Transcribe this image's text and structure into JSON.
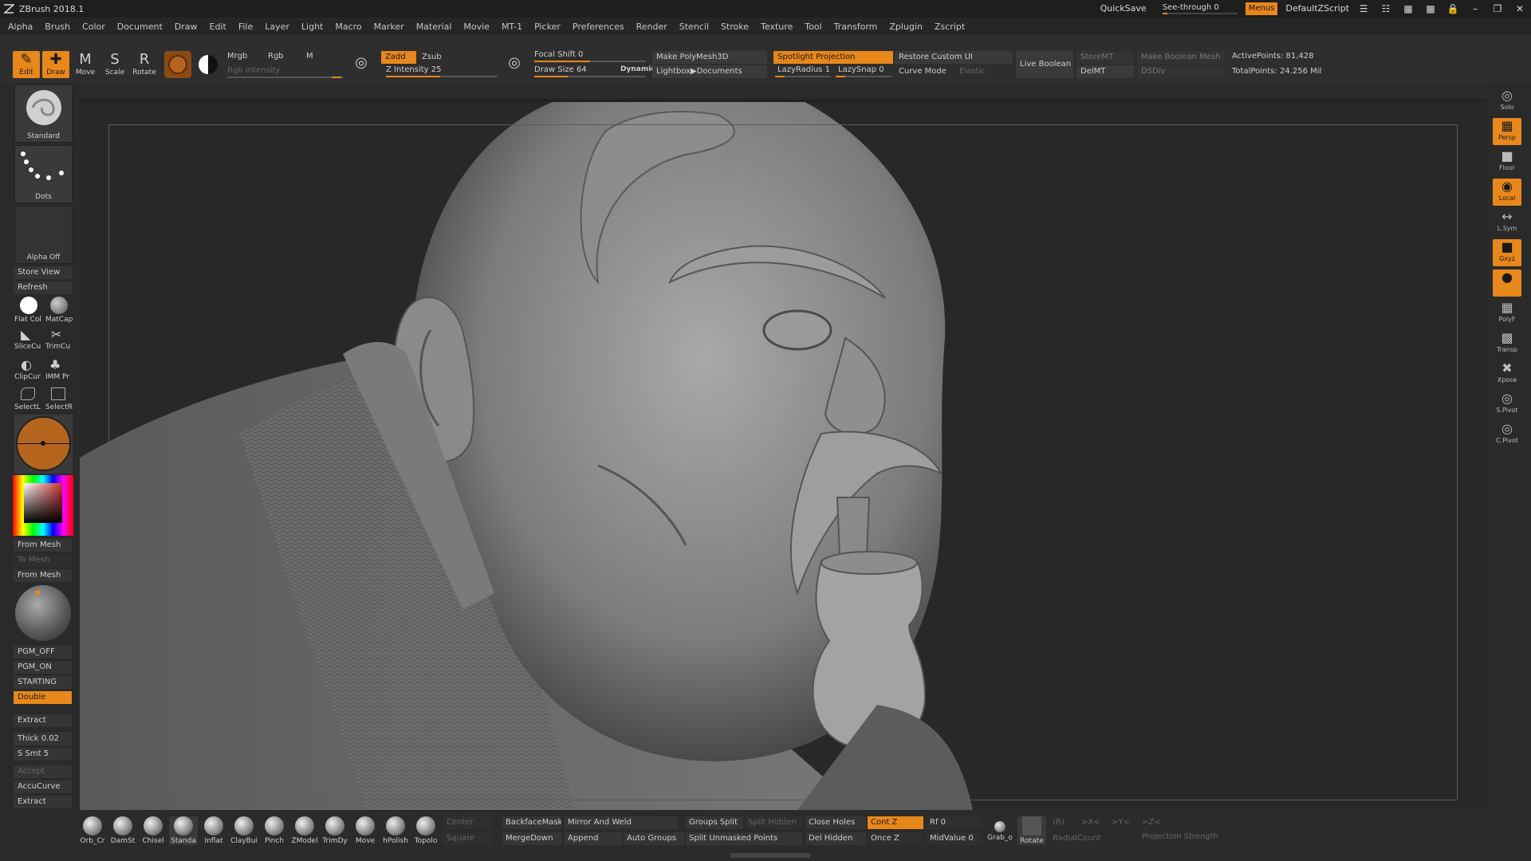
{
  "app": {
    "title": "ZBrush 2018.1"
  },
  "titlebar": {
    "quicksave": "QuickSave",
    "seethrough": "See-through   0",
    "menus": "Menus",
    "script": "DefaultZScript"
  },
  "menu": [
    "Alpha",
    "Brush",
    "Color",
    "Document",
    "Draw",
    "Edit",
    "File",
    "Layer",
    "Light",
    "Macro",
    "Marker",
    "Material",
    "Movie",
    "MT-1",
    "Picker",
    "Preferences",
    "Render",
    "Stencil",
    "Stroke",
    "Texture",
    "Tool",
    "Transform",
    "Zplugin",
    "Zscript"
  ],
  "toolbar": {
    "edit": "Edit",
    "draw": "Draw",
    "move": "Move",
    "scale": "Scale",
    "rotate": "Rotate",
    "mrgb": "Mrgb",
    "rgb": "Rgb",
    "m": "M",
    "rgb_intensity": "Rgb Intensity",
    "zadd": "Zadd",
    "zsub": "Zsub",
    "z_intensity": "Z Intensity 25",
    "focal_shift": "Focal Shift 0",
    "draw_size": "Draw Size 64",
    "dynamic": "Dynamic",
    "make_polymesh": "Make PolyMesh3D",
    "lightbox": "Lightbox▶Documents",
    "spotlight": "Spotlight Projection",
    "lazyradius": "LazyRadius 1",
    "lazysnap": "LazySnap 0",
    "restore_ui": "Restore Custom UI",
    "curve_mode": "Curve Mode",
    "elastic": "Elastic",
    "live_boolean": "Live Boolean",
    "storemt": "StoreMT",
    "delmt": "DelMT",
    "make_boolean": "Make Boolean Mesh",
    "dsdiv": "DSDiv",
    "active_points": "ActivePoints: 81,428",
    "total_points": "TotalPoints: 24.256 Mil"
  },
  "left": {
    "standard": "Standard",
    "dots": "Dots",
    "alpha_off": "Alpha Off",
    "store_view": "Store View",
    "refresh": "Refresh",
    "flat_col": "Flat Col",
    "matcap": "MatCap",
    "slicecu": "SliceCu",
    "trimcu": "TrimCu",
    "clipcur": "ClipCur",
    "imm": "IMM Pr",
    "selectl": "SelectL",
    "selectr": "SelectR",
    "from_mesh": "From Mesh",
    "to_mesh": "To Mesh",
    "from_mesh2": "From Mesh",
    "pgm_off": "PGM_OFF",
    "pgm_on": "PGM_ON",
    "starting": "STARTING",
    "double": "Double",
    "extract": "Extract",
    "thick": "Thick 0.02",
    "ssmt": "S Smt 5",
    "accept": "Accept",
    "accucurve": "AccuCurve",
    "extract2": "Extract"
  },
  "right": [
    "Solo",
    "Persp",
    "Floor",
    "Local",
    "L.Sym",
    "Gxyz",
    "",
    "PolyF",
    "Transp",
    "Xpose",
    "S.Pivot",
    "C.Pivot"
  ],
  "bottom": {
    "brushes": [
      "Orb_Cr",
      "DamSt",
      "Chisel",
      "Standa",
      "Inflat",
      "ClayBui",
      "Pinch",
      "ZModel",
      "TrimDy",
      "Move",
      "hPolish",
      "Topolo"
    ],
    "center": "Center",
    "square": "Square",
    "backfacemask": "BackfaceMask",
    "mergedown": "MergeDown",
    "mirror_weld": "Mirror And Weld",
    "append": "Append",
    "auto_groups": "Auto Groups",
    "groups_split": "Groups Split",
    "split_hidden": "Split Hidden",
    "split_unmasked": "Split Unmasked Points",
    "close_holes": "Close Holes",
    "del_hidden": "Del Hidden",
    "cont_z": "Cont Z",
    "once_z": "Once Z",
    "rf": "Rf 0",
    "midvalue": "MidValue 0",
    "grab": "Grab_o",
    "rotate": "Rotate",
    "r": "(R)",
    "xaxis": ">X<",
    "yaxis": ">Y<",
    "zaxis": ">Z<",
    "radialcount": "RadialCount",
    "projection": "Projection Strength"
  },
  "colors": {
    "accent": "#e8871a",
    "bg": "#2b2b2b",
    "viewport": "#282828"
  }
}
